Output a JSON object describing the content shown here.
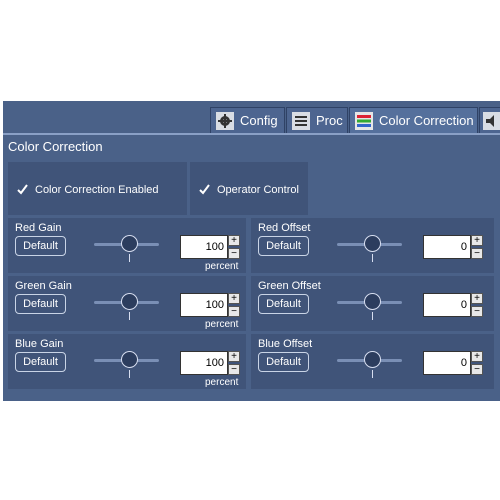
{
  "tabs": [
    {
      "label": "Config",
      "icon": "gear-icon"
    },
    {
      "label": "Proc",
      "icon": "processing-icon"
    },
    {
      "label": "Color Correction",
      "icon": "color-bars-icon",
      "active": true
    },
    {
      "label": "",
      "icon": "audio-icon"
    }
  ],
  "section_title": "Color Correction",
  "checkboxes": [
    {
      "label": "Color Correction Enabled",
      "checked": true
    },
    {
      "label": "Operator Control",
      "checked": true
    }
  ],
  "controls": [
    {
      "label": "Red Gain",
      "button": "Default",
      "value": "100",
      "unit": "percent"
    },
    {
      "label": "Red Offset",
      "button": "Default",
      "value": "0",
      "unit": ""
    },
    {
      "label": "Green Gain",
      "button": "Default",
      "value": "100",
      "unit": "percent"
    },
    {
      "label": "Green Offset",
      "button": "Default",
      "value": "0",
      "unit": ""
    },
    {
      "label": "Blue Gain",
      "button": "Default",
      "value": "100",
      "unit": "percent"
    },
    {
      "label": "Blue Offset",
      "button": "Default",
      "value": "0",
      "unit": ""
    }
  ],
  "stepper": {
    "up": "+",
    "down": "−"
  },
  "colors": {
    "panel": "#4a6188",
    "cell": "#405479",
    "text": "#ffffff"
  }
}
